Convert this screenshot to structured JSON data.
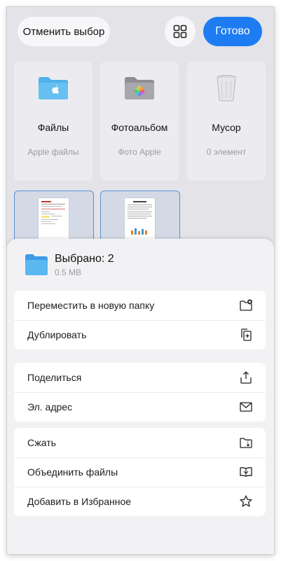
{
  "header": {
    "cancel_label": "Отменить выбор",
    "done_label": "Готово",
    "grid_icon": "grid-icon"
  },
  "folders": [
    {
      "title": "Файлы",
      "subtitle": "Apple файлы",
      "icon": "folder-apple-icon"
    },
    {
      "title": "Фотоальбом",
      "subtitle": "Фото Apple",
      "icon": "photos-folder-icon"
    },
    {
      "title": "Мусор",
      "subtitle": "0 элемент",
      "icon": "trash-icon"
    }
  ],
  "selection": {
    "title": "Выбрано: 2",
    "size": "0.5 MB"
  },
  "actions": [
    [
      {
        "label": "Переместить в новую папку",
        "icon": "new-folder-icon"
      },
      {
        "label": "Дублировать",
        "icon": "duplicate-icon"
      }
    ],
    [
      {
        "label": "Поделиться",
        "icon": "share-icon"
      },
      {
        "label": "Эл. адрес",
        "icon": "mail-icon"
      }
    ],
    [
      {
        "label": "Сжать",
        "icon": "zip-icon"
      },
      {
        "label": "Объединить файлы",
        "icon": "merge-icon"
      },
      {
        "label": "Добавить в Избранное",
        "icon": "star-icon"
      }
    ]
  ],
  "colors": {
    "accent": "#1d7cf2",
    "selection_border": "#5b8fd6",
    "folder_blue": "#5ab8f0"
  }
}
